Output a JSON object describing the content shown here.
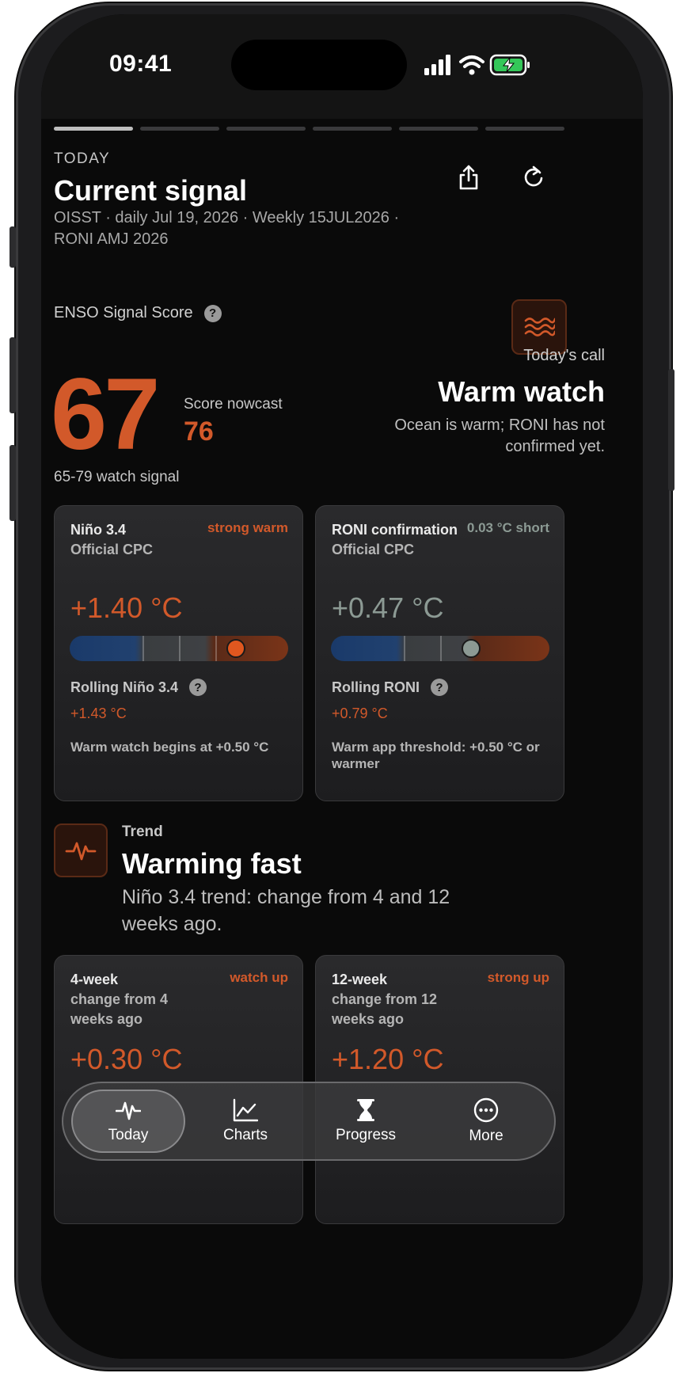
{
  "status": {
    "time": "09:41"
  },
  "header": {
    "eyebrow": "TODAY",
    "title": "Current signal",
    "subtitle": "OISST · daily Jul 19, 2026 · Weekly 15JUL2026 · RONI AMJ 2026",
    "share_icon": "share-icon",
    "refresh_icon": "refresh-icon"
  },
  "score": {
    "label": "ENSO Signal Score",
    "help": "?",
    "value": "67",
    "nowcast_label": "Score nowcast",
    "nowcast_value": "76",
    "band_note": "65-79 watch signal",
    "icon": "waves-icon"
  },
  "call": {
    "label": "Today's call",
    "title": "Warm watch",
    "description": "Ocean is warm; RONI has not confirmed yet."
  },
  "cards_top": [
    {
      "name": "Niño 3.4",
      "source": "Official CPC",
      "tag": "strong warm",
      "value": "+1.40 °C",
      "gauge_position": 0.76,
      "rolling_label": "Rolling Niño 3.4",
      "rolling_help": "?",
      "rolling_value": "+1.43 °C",
      "note": "Warm watch begins at +0.50 °C"
    },
    {
      "name": "RONI confirmation",
      "source": "Official CPC",
      "tag": "0.03 °C short",
      "value": "+0.47 °C",
      "gauge_position": 0.64,
      "rolling_label": "Rolling RONI",
      "rolling_help": "?",
      "rolling_value": "+0.79 °C",
      "note": "Warm app threshold: +0.50 °C or warmer"
    }
  ],
  "trend": {
    "icon": "pulse-icon",
    "label": "Trend",
    "title": "Warming fast",
    "description": "Niño 3.4 trend: change from 4 and 12 weeks ago."
  },
  "cards_bottom": [
    {
      "name": "4-week",
      "source": "change from 4 weeks ago",
      "tag": "watch up",
      "value": "+0.30 °C"
    },
    {
      "name": "12-week",
      "source": "change from 12 weeks ago",
      "tag": "strong up",
      "value": "+1.20 °C"
    }
  ],
  "tabs": [
    {
      "label": "Today",
      "icon": "pulse-icon",
      "active": true
    },
    {
      "label": "Charts",
      "icon": "chart-icon",
      "active": false
    },
    {
      "label": "Progress",
      "icon": "hourglass-icon",
      "active": false
    },
    {
      "label": "More",
      "icon": "more-icon",
      "active": false
    }
  ],
  "colors": {
    "accent": "#d2592a",
    "muted_green": "#8c9a94",
    "background": "#0a0a0a"
  }
}
